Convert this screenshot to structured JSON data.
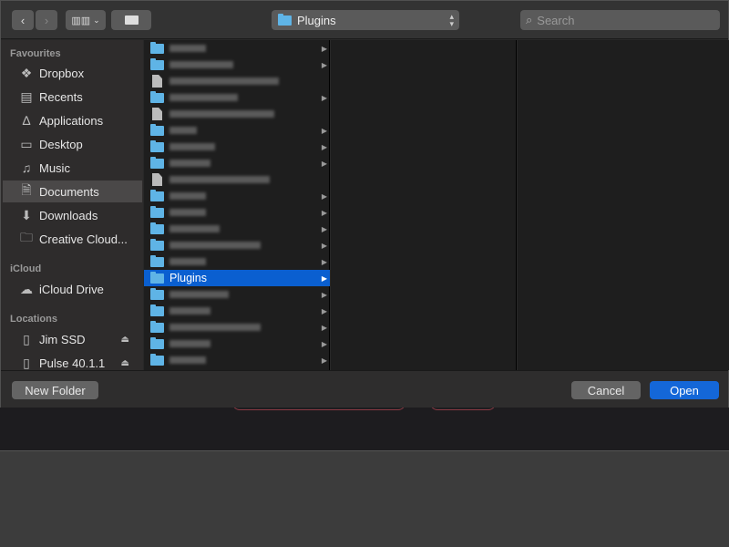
{
  "toolbar": {
    "path_label": "Plugins",
    "search_placeholder": "Search"
  },
  "sidebar": {
    "favourites_label": "Favourites",
    "favourites": [
      {
        "label": "Dropbox",
        "icon": "dropbox-icon"
      },
      {
        "label": "Recents",
        "icon": "recents-icon"
      },
      {
        "label": "Applications",
        "icon": "applications-icon"
      },
      {
        "label": "Desktop",
        "icon": "desktop-icon"
      },
      {
        "label": "Music",
        "icon": "music-icon"
      },
      {
        "label": "Documents",
        "icon": "documents-icon",
        "selected": true
      },
      {
        "label": "Downloads",
        "icon": "downloads-icon"
      },
      {
        "label": "Creative Cloud...",
        "icon": "folder-icon"
      }
    ],
    "icloud_label": "iCloud",
    "icloud": [
      {
        "label": "iCloud Drive",
        "icon": "cloud-icon"
      }
    ],
    "locations_label": "Locations",
    "locations": [
      {
        "label": "Jim SSD",
        "icon": "drive-icon"
      },
      {
        "label": "Pulse 40.1.1",
        "icon": "drive-icon"
      }
    ]
  },
  "browser": {
    "selected_item": "Plugins"
  },
  "footer": {
    "new_folder": "New Folder",
    "cancel": "Cancel",
    "open": "Open"
  },
  "colors": {
    "accent": "#1467d8",
    "folder": "#5fb4e6"
  }
}
